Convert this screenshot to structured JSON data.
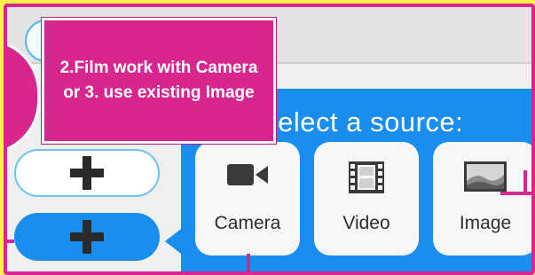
{
  "annotation": {
    "callout_text": "2.Film work with Camera or 3. use existing Image"
  },
  "source_panel": {
    "title": "Select a source:",
    "options": [
      {
        "label": "Camera",
        "icon": "video-camera-icon"
      },
      {
        "label": "Video",
        "icon": "film-strip-icon"
      },
      {
        "label": "Image",
        "icon": "landscape-image-icon"
      }
    ]
  },
  "colors": {
    "accent_blue": "#1a8df0",
    "annotation_magenta": "#d9268f",
    "background_yellow": "#fdf24a"
  }
}
